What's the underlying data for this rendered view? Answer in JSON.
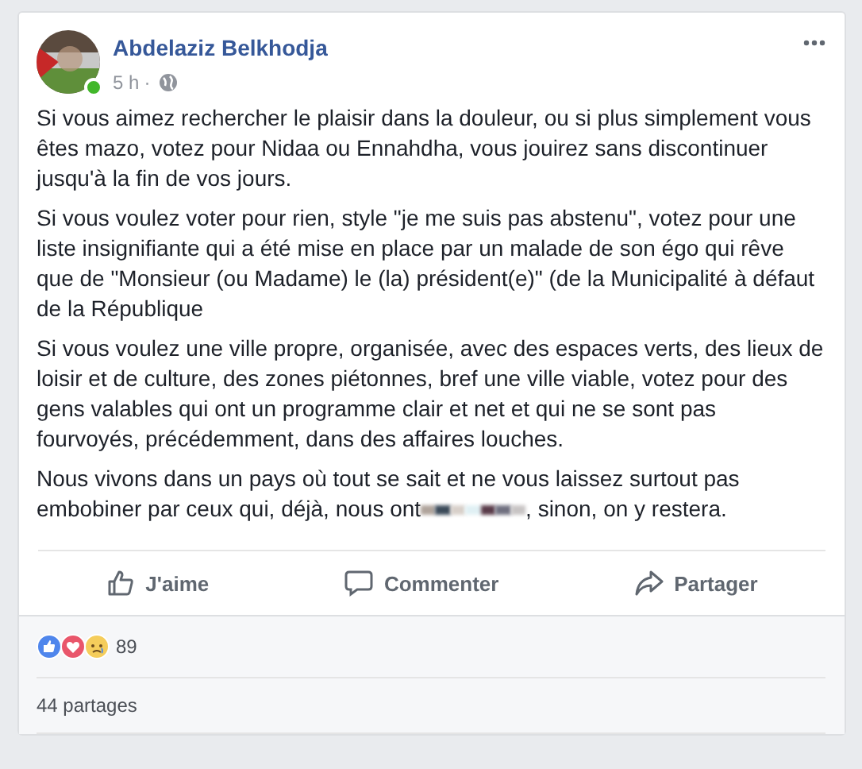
{
  "post": {
    "author": "Abdelaziz Belkhodja",
    "online": true,
    "time": "5 h",
    "separator": "·",
    "paragraphs": [
      {
        "text": "Si vous aimez rechercher le plaisir dans la douleur, ou si plus simplement vous êtes mazo, votez pour Nidaa ou Ennahdha, vous jouirez sans discontinuer jusqu'à la fin de vos jours."
      },
      {
        "text": "Si vous voulez voter pour rien, style \"je me suis pas abstenu\", votez pour une liste insignifiante qui a été mise en place par un malade de son égo qui rêve que de \"Monsieur (ou Madame) le (la) président(e)\" (de la Municipalité à défaut de la République"
      },
      {
        "text": "Si vous voulez une ville propre, organisée, avec des espaces verts, des lieux de loisir et de culture, des zones piétonnes, bref une ville viable, votez pour des gens valables qui ont un programme clair et net et qui ne se sont pas fourvoyés, précédemment, dans des affaires louches."
      },
      {
        "text": "Nous vivons dans un pays où tout se sait et ne vous laissez surtout pas embobiner par ceux qui, déjà, nous ont",
        "redacted": true,
        "text_after": ", sinon, on y restera."
      }
    ],
    "actions": [
      {
        "kind": "like",
        "label": "J'aime"
      },
      {
        "kind": "comment",
        "label": "Commenter"
      },
      {
        "kind": "share",
        "label": "Partager"
      }
    ],
    "reactions": {
      "types": [
        {
          "kind": "like"
        },
        {
          "kind": "love"
        },
        {
          "kind": "sad"
        }
      ],
      "count": "89"
    },
    "shares": "44 partages"
  }
}
